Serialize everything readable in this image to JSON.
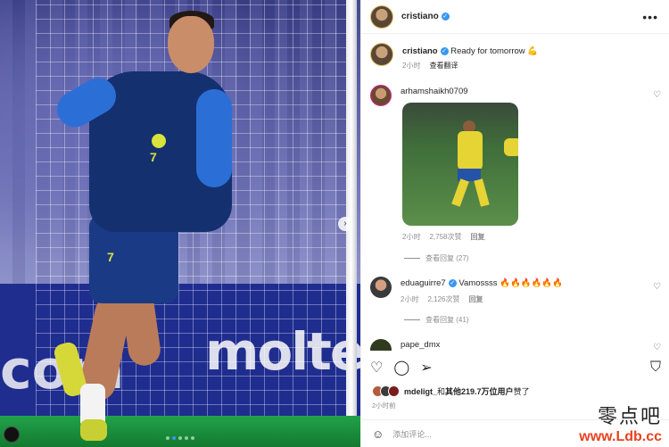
{
  "post": {
    "author": "cristiano",
    "caption_user": "cristiano",
    "caption": "Ready for tomorrow 💪",
    "caption_time": "2小时",
    "caption_translate": "查看翻译",
    "photo_text_left": "com",
    "photo_text_right": "molte"
  },
  "comments": [
    {
      "user": "arhamshaikh0709",
      "time": "2小时",
      "likes": "2,758次赞",
      "reply": "回复",
      "view_replies": "查看回复 (27)"
    },
    {
      "user": "eduaguirre7",
      "text": "Vamossss 🔥🔥🔥🔥🔥🔥",
      "time": "2小时",
      "likes": "2,126次赞",
      "reply": "回复",
      "view_replies": "查看回复 (41)"
    },
    {
      "user": "pape_dmx"
    }
  ],
  "likes": {
    "user": "mdeligt_",
    "mid": "和",
    "others": "其他219.7万位用户",
    "tail": "赞了"
  },
  "time_ago": "2小时前",
  "add_comment_placeholder": "添加评论...",
  "watermark": {
    "zh": "零点吧",
    "url": "www.Ldb.cc"
  },
  "colors": {
    "verified": "#3897f0",
    "jersey": "#15306f",
    "sleeve": "#2b6fd6",
    "kit_yellow": "#d8e33b"
  }
}
